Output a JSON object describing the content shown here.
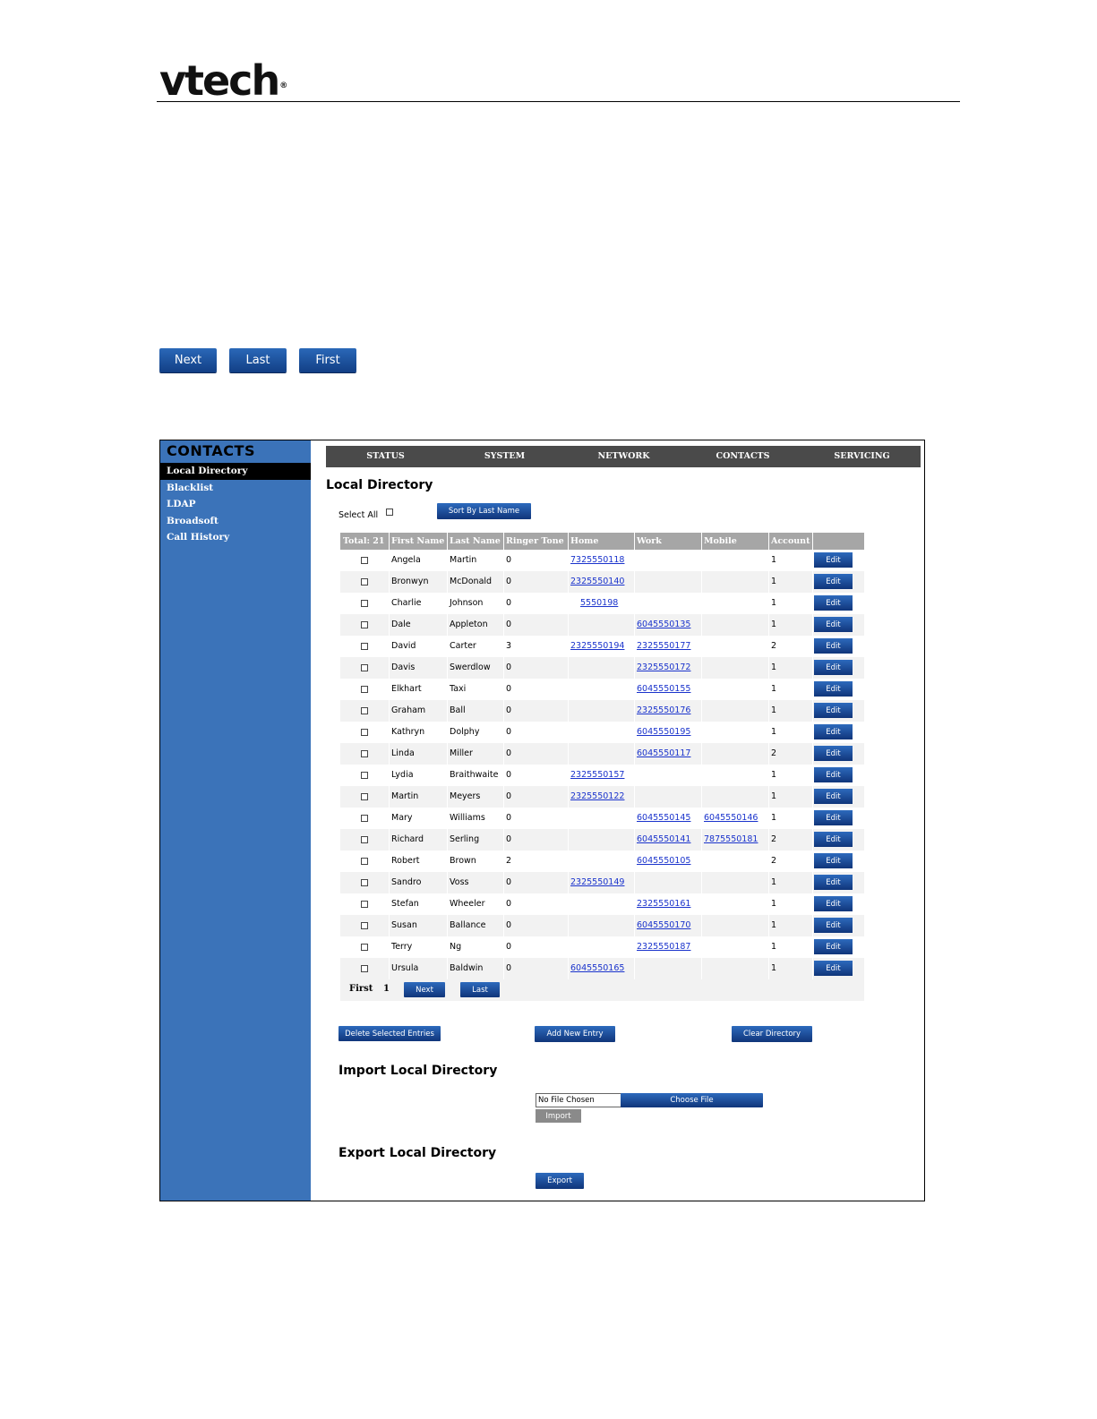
{
  "brand": {
    "logo_text": "vtech",
    "registered": "®"
  },
  "pager_buttons": [
    "Next",
    "Last",
    "First"
  ],
  "sidebar": {
    "title": "CONTACTS",
    "items": [
      "Local Directory",
      "Blacklist",
      "LDAP",
      "Broadsoft",
      "Call History"
    ],
    "active": "Local Directory"
  },
  "topnav": [
    "STATUS",
    "SYSTEM",
    "NETWORK",
    "CONTACTS",
    "SERVICING"
  ],
  "main": {
    "heading": "Local Directory",
    "select_all_label": "Select All",
    "sort_button": "Sort By Last Name"
  },
  "table": {
    "headers": [
      "Total: 21",
      "First Name",
      "Last Name",
      "Ringer Tone",
      "Home",
      "Work",
      "Mobile",
      "Account"
    ],
    "edit_label": "Edit",
    "rows": [
      {
        "first": "Angela",
        "last": "Martin",
        "ringer": "0",
        "home": "7325550118",
        "work": "",
        "mobile": "",
        "account": "1"
      },
      {
        "first": "Bronwyn",
        "last": "McDonald",
        "ringer": "0",
        "home": "2325550140",
        "work": "",
        "mobile": "",
        "account": "1"
      },
      {
        "first": "Charlie",
        "last": "Johnson",
        "ringer": "0",
        "home": "5550198",
        "work": "",
        "mobile": "",
        "account": "1"
      },
      {
        "first": "Dale",
        "last": "Appleton",
        "ringer": "0",
        "home": "",
        "work": "6045550135",
        "mobile": "",
        "account": "1"
      },
      {
        "first": "David",
        "last": "Carter",
        "ringer": "3",
        "home": "2325550194",
        "work": "2325550177",
        "mobile": "",
        "account": "2"
      },
      {
        "first": "Davis",
        "last": "Swerdlow",
        "ringer": "0",
        "home": "",
        "work": "2325550172",
        "mobile": "",
        "account": "1"
      },
      {
        "first": "Elkhart",
        "last": "Taxi",
        "ringer": "0",
        "home": "",
        "work": "6045550155",
        "mobile": "",
        "account": "1"
      },
      {
        "first": "Graham",
        "last": "Ball",
        "ringer": "0",
        "home": "",
        "work": "2325550176",
        "mobile": "",
        "account": "1"
      },
      {
        "first": "Kathryn",
        "last": "Dolphy",
        "ringer": "0",
        "home": "",
        "work": "6045550195",
        "mobile": "",
        "account": "1"
      },
      {
        "first": "Linda",
        "last": "Miller",
        "ringer": "0",
        "home": "",
        "work": "6045550117",
        "mobile": "",
        "account": "2"
      },
      {
        "first": "Lydia",
        "last": "Braithwaite",
        "ringer": "0",
        "home": "2325550157",
        "work": "",
        "mobile": "",
        "account": "1"
      },
      {
        "first": "Martin",
        "last": "Meyers",
        "ringer": "0",
        "home": "2325550122",
        "work": "",
        "mobile": "",
        "account": "1"
      },
      {
        "first": "Mary",
        "last": "Williams",
        "ringer": "0",
        "home": "",
        "work": "6045550145",
        "mobile": "6045550146",
        "account": "1"
      },
      {
        "first": "Richard",
        "last": "Serling",
        "ringer": "0",
        "home": "",
        "work": "6045550141",
        "mobile": "7875550181",
        "account": "2"
      },
      {
        "first": "Robert",
        "last": "Brown",
        "ringer": "2",
        "home": "",
        "work": "6045550105",
        "mobile": "",
        "account": "2"
      },
      {
        "first": "Sandro",
        "last": "Voss",
        "ringer": "0",
        "home": "2325550149",
        "work": "",
        "mobile": "",
        "account": "1"
      },
      {
        "first": "Stefan",
        "last": "Wheeler",
        "ringer": "0",
        "home": "",
        "work": "2325550161",
        "mobile": "",
        "account": "1"
      },
      {
        "first": "Susan",
        "last": "Ballance",
        "ringer": "0",
        "home": "",
        "work": "6045550170",
        "mobile": "",
        "account": "1"
      },
      {
        "first": "Terry",
        "last": "Ng",
        "ringer": "0",
        "home": "",
        "work": "2325550187",
        "mobile": "",
        "account": "1"
      },
      {
        "first": "Ursula",
        "last": "Baldwin",
        "ringer": "0",
        "home": "6045550165",
        "work": "",
        "mobile": "",
        "account": "1"
      }
    ],
    "footer": {
      "first_label": "First",
      "page": "1",
      "next_label": "Next",
      "last_label": "Last"
    }
  },
  "actions": {
    "delete_label": "Delete Selected Entries",
    "add_label": "Add New Entry",
    "clear_label": "Clear Directory"
  },
  "import": {
    "heading": "Import Local Directory",
    "file_status": "No File Chosen",
    "choose_label": "Choose File",
    "import_label": "Import"
  },
  "export": {
    "heading": "Export Local Directory",
    "export_label": "Export"
  }
}
